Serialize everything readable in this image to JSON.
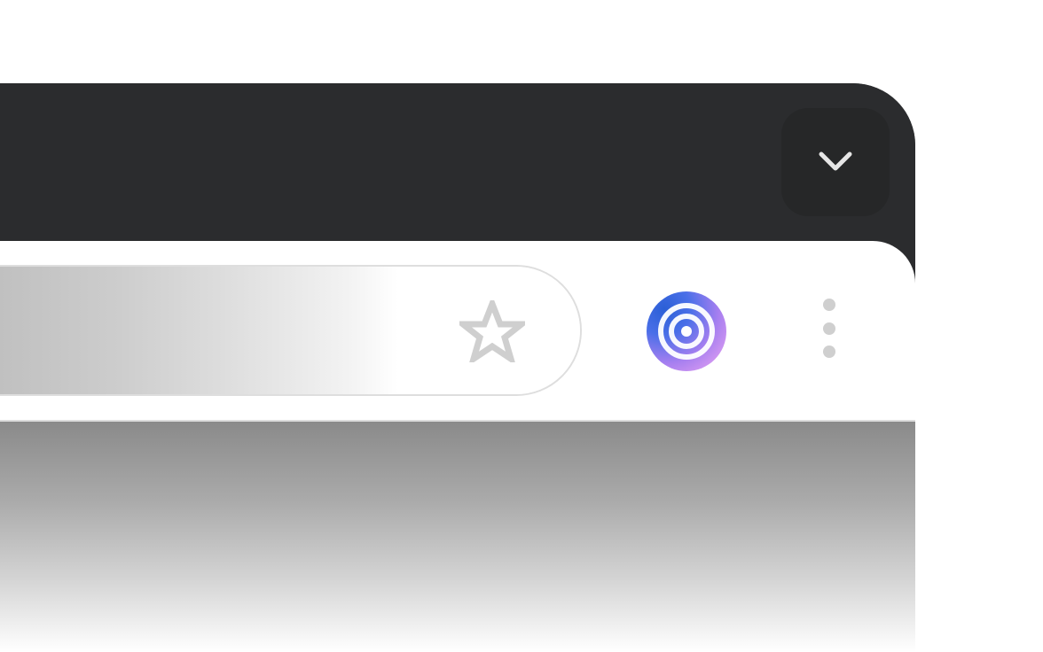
{
  "window": {
    "tab_menu": {
      "icon": "chevron-down-icon"
    }
  },
  "toolbar": {
    "omnibox": {
      "bookmark_icon": "star-outline-icon"
    },
    "assistant_icon": "assistant-swirl-icon",
    "menu_icon": "more-vertical-icon"
  },
  "colors": {
    "titlebar": "#2b2c2e",
    "toolbar": "#ffffff",
    "chevron": "#e6e6e6",
    "star": "#cfcfcf",
    "kebab": "#cfcfcf",
    "assistant_gradient": [
      "#2b5fd6",
      "#a77ff0",
      "#f2a8f2"
    ]
  }
}
